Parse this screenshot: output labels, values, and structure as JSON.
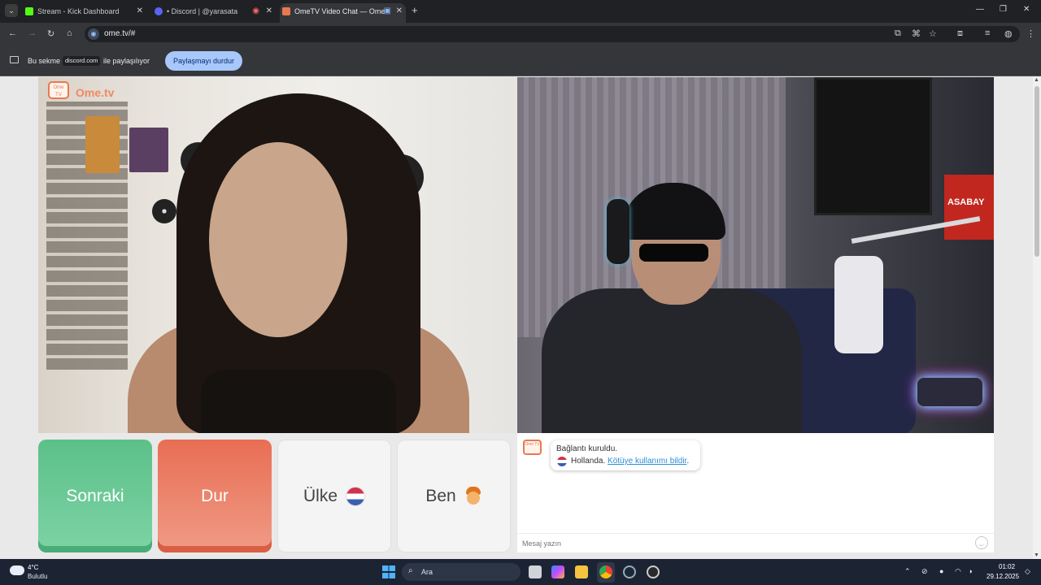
{
  "browser": {
    "tabs": [
      {
        "label": "Stream - Kick Dashboard",
        "favicon_color": "#53fc18"
      },
      {
        "label": "• Discord | @yarasata",
        "favicon_color": "#5865f2"
      },
      {
        "label": "OmeTV Video Chat — Ome",
        "favicon_color": "#e8794f"
      }
    ],
    "url": "ome.tv/#"
  },
  "sharebar": {
    "prefix": "Bu sekme",
    "domain": "discord.com",
    "suffix": "ile paylaşılıyor",
    "stop_label": "Paylaşmayı durdur"
  },
  "ome": {
    "logo_text": "Ome.tv",
    "badge_text": "Ome TV"
  },
  "local_video": {
    "sign_text": "ASABAY"
  },
  "controls": {
    "next_label": "Sonraki",
    "stop_label": "Dur",
    "country_label": "Ülke",
    "me_label": "Ben"
  },
  "chat": {
    "connected_text": "Bağlantı kuruldu.",
    "country_text": "Hollanda.",
    "report_link": "Kötüye kullanımı bildir",
    "report_suffix": ".",
    "input_placeholder": "Mesaj yazın"
  },
  "taskbar": {
    "weather_temp": "4°C",
    "weather_desc": "Bulutlu",
    "search_label": "Ara",
    "time": "01:02",
    "date": "29.12.2025"
  },
  "colors": {
    "next_button": "#5cc089",
    "stop_button": "#e86e54",
    "ome_brand": "#e8794f",
    "link": "#2a8fd8"
  }
}
